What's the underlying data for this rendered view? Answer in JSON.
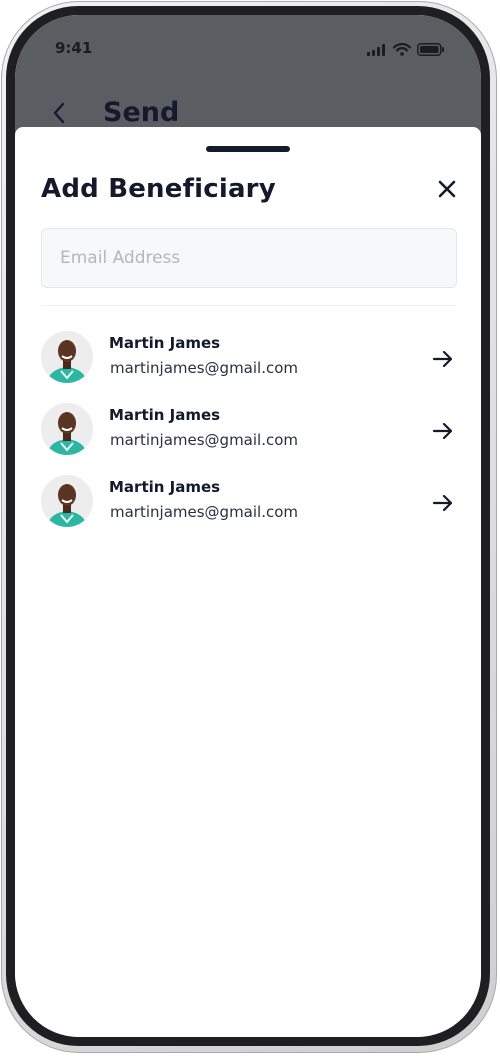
{
  "status_bar": {
    "time": "9:41",
    "icons": [
      "signal-icon",
      "wifi-icon",
      "battery-icon"
    ]
  },
  "background_screen": {
    "title": "Send",
    "back_icon": "chevron-left-icon"
  },
  "sheet": {
    "title": "Add Beneficiary",
    "close_icon": "close-icon",
    "email_input": {
      "placeholder": "Email Address",
      "value": ""
    },
    "beneficiaries": [
      {
        "name": "Martin James",
        "email": "martinjames@gmail.com",
        "action_icon": "arrow-right-icon"
      },
      {
        "name": "Martin James",
        "email": "martinjames@gmail.com",
        "action_icon": "arrow-right-icon"
      },
      {
        "name": "Martin James",
        "email": "martinjames@gmail.com",
        "action_icon": "arrow-right-icon"
      }
    ]
  },
  "colors": {
    "backdrop": "#5a5d62",
    "text_primary": "#141a2b",
    "input_bg": "#f7f8f9",
    "input_border": "#e4e7ea",
    "placeholder": "#b3b7bd",
    "avatar_shirt": "#2bb7a4"
  }
}
